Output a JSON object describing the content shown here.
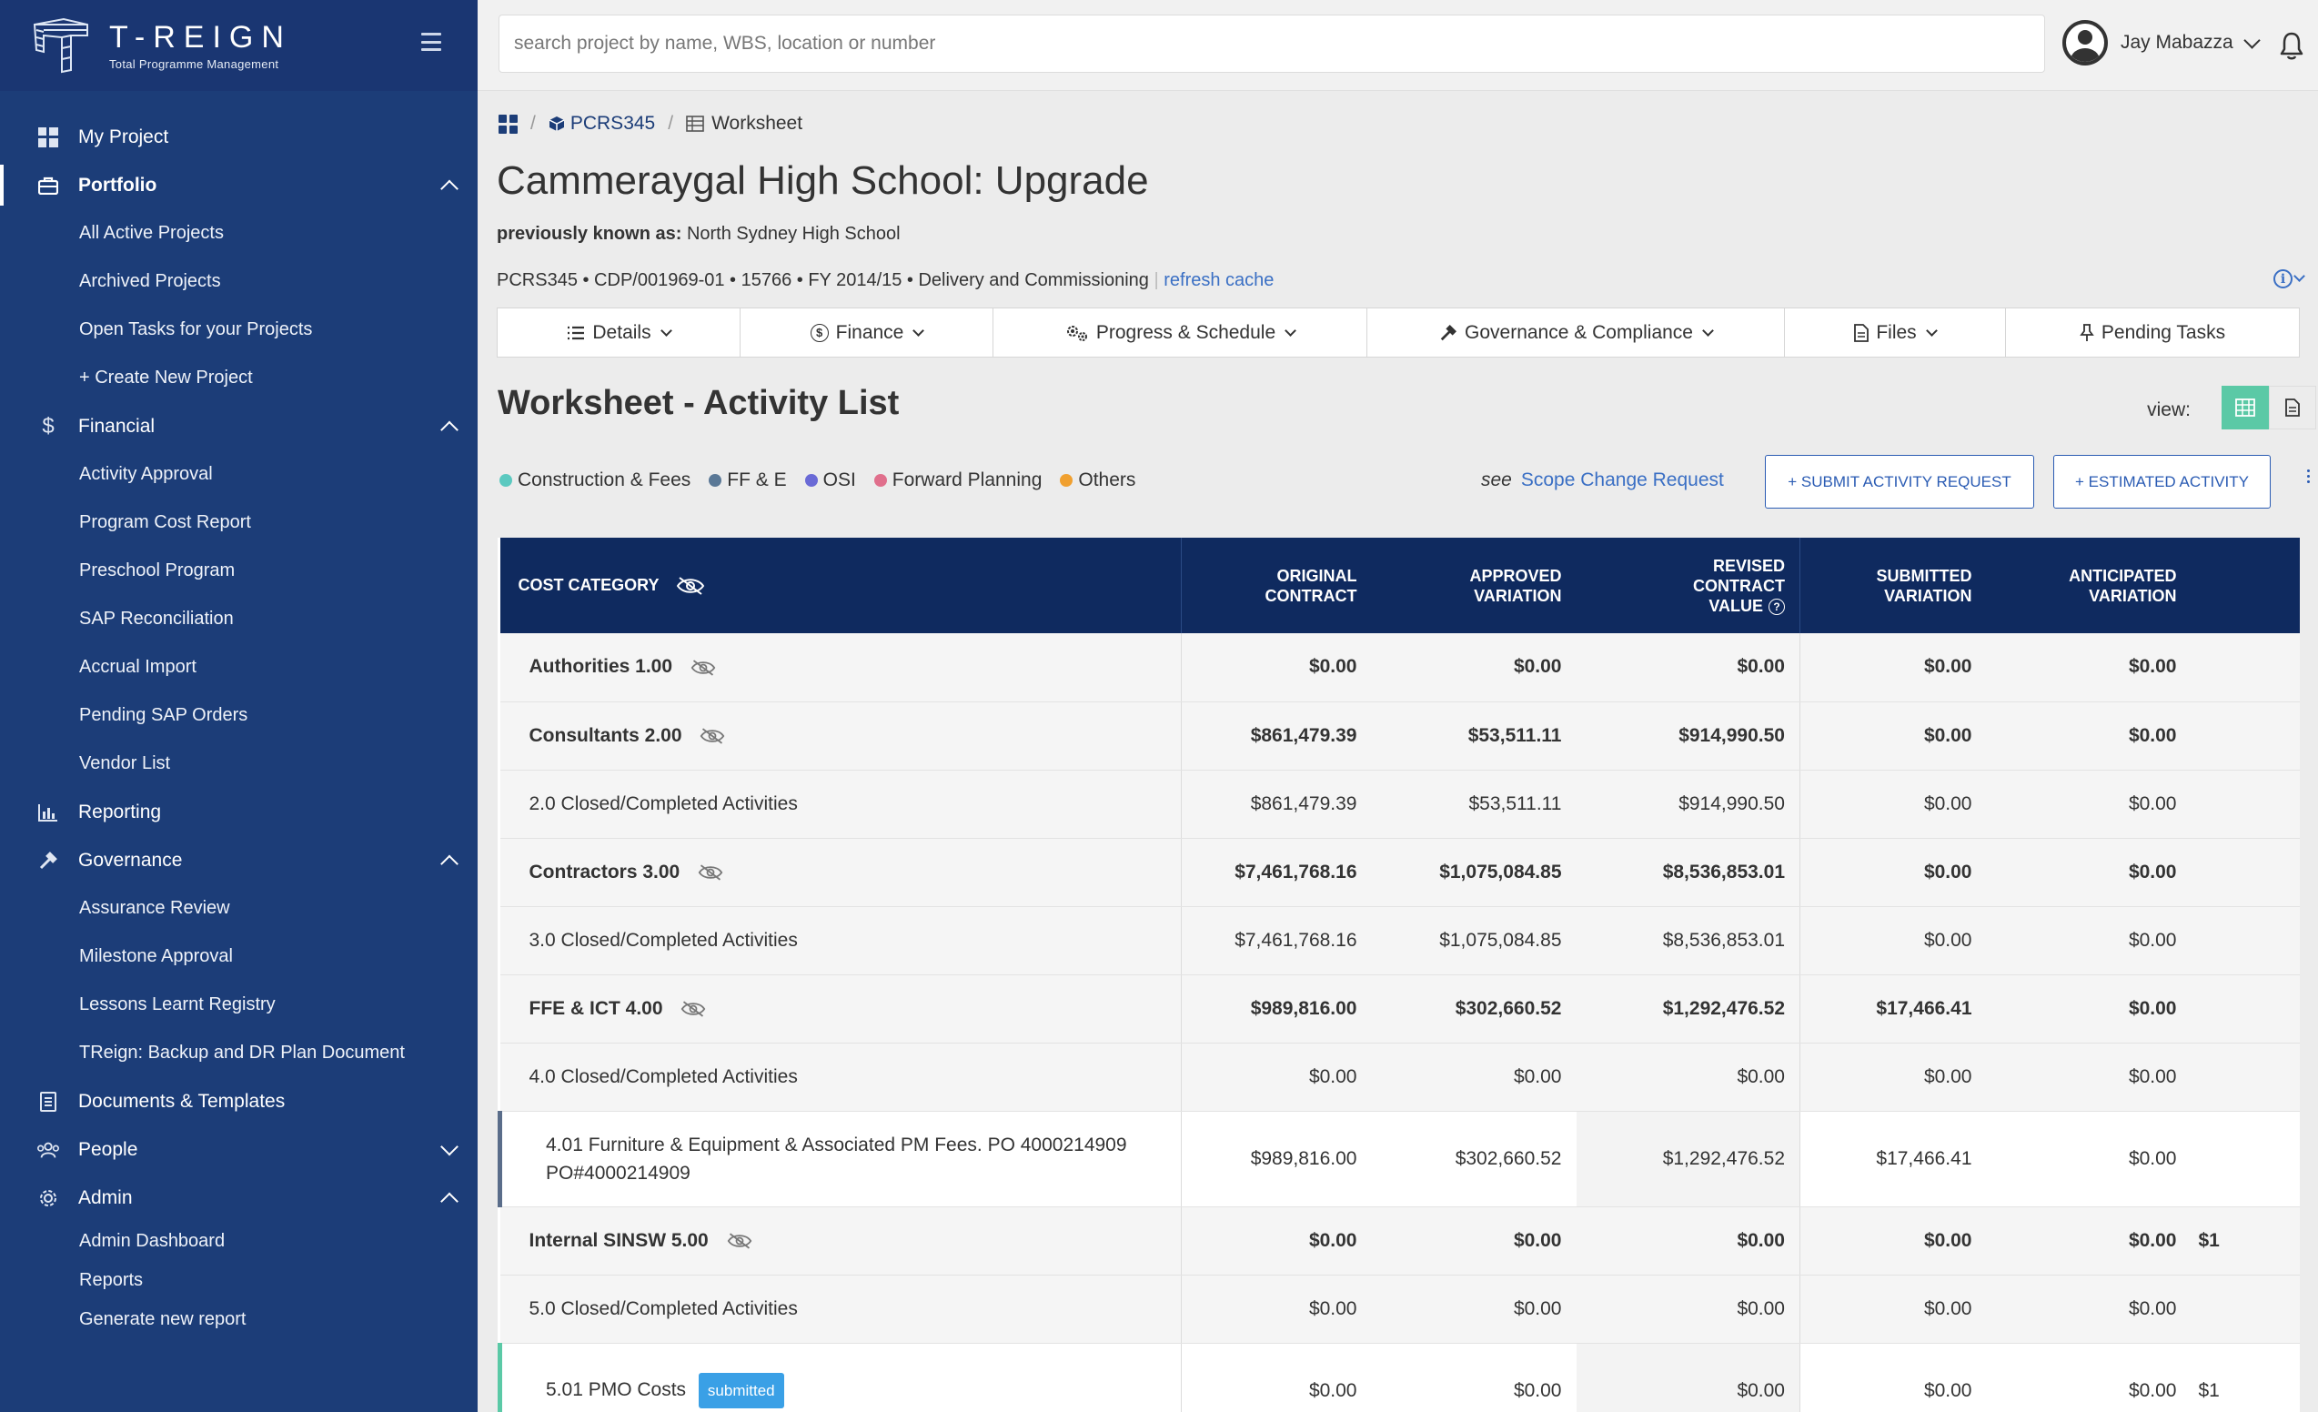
{
  "brand": {
    "title": "T-REIGN",
    "subtitle": "Total Programme Management"
  },
  "sidebar": {
    "items": [
      {
        "label": "My Project",
        "icon": "dashboard-icon"
      },
      {
        "label": "Portfolio",
        "icon": "briefcase-icon",
        "active": true,
        "expanded": true,
        "children": [
          "All Active Projects",
          "Archived Projects",
          "Open Tasks for your Projects",
          "+ Create New Project"
        ]
      },
      {
        "label": "Financial",
        "icon": "dollar-icon",
        "expanded": true,
        "children": [
          "Activity Approval",
          "Program Cost Report",
          "Preschool Program",
          "SAP Reconciliation",
          "Accrual Import",
          "Pending SAP Orders",
          "Vendor List"
        ]
      },
      {
        "label": "Reporting",
        "icon": "bar-chart-icon"
      },
      {
        "label": "Governance",
        "icon": "gavel-icon",
        "expanded": true,
        "children": [
          "Assurance Review",
          "Milestone Approval",
          "Lessons Learnt Registry",
          "TReign: Backup and DR Plan Document"
        ]
      },
      {
        "label": "Documents & Templates",
        "icon": "document-icon"
      },
      {
        "label": "People",
        "icon": "people-icon",
        "expanded": false
      },
      {
        "label": "Admin",
        "icon": "gear-icon",
        "expanded": true,
        "children": [
          "Admin Dashboard",
          "Reports",
          "Generate new report"
        ]
      }
    ]
  },
  "topbar": {
    "search_placeholder": "search project by name, WBS, location or number",
    "user_name": "Jay Mabazza"
  },
  "breadcrumb": {
    "project": "PCRS345",
    "current": "Worksheet"
  },
  "project": {
    "title": "Cammeraygal High School: Upgrade",
    "prev_label": "previously known as:",
    "prev_name": "North Sydney High School",
    "meta": "PCRS345 • CDP/001969-01 • 15766 • FY 2014/15 • Delivery and Commissioning",
    "refresh": "refresh cache"
  },
  "tabs": [
    {
      "label": "Details",
      "icon": "list-icon",
      "dropdown": true
    },
    {
      "label": "Finance",
      "icon": "dollar-circle-icon",
      "dropdown": true
    },
    {
      "label": "Progress & Schedule",
      "icon": "gears-icon",
      "dropdown": true
    },
    {
      "label": "Governance & Compliance",
      "icon": "gavel-icon",
      "dropdown": true
    },
    {
      "label": "Files",
      "icon": "file-icon",
      "dropdown": true
    },
    {
      "label": "Pending Tasks",
      "icon": "pin-icon",
      "dropdown": false
    }
  ],
  "worksheet": {
    "title": "Worksheet - Activity List",
    "view_label": "view:",
    "legend": [
      {
        "label": "Construction & Fees",
        "color": "#5bc9c0"
      },
      {
        "label": "FF & E",
        "color": "#5a7896"
      },
      {
        "label": "OSI",
        "color": "#6a6ad6"
      },
      {
        "label": "Forward Planning",
        "color": "#e06f8c"
      },
      {
        "label": "Others",
        "color": "#f0a030"
      }
    ],
    "see_label": "see",
    "scope_link": "Scope Change Request",
    "submit_btn": "+ SUBMIT ACTIVITY REQUEST",
    "estimated_btn": "+ ESTIMATED ACTIVITY"
  },
  "table": {
    "headers": {
      "category": "COST CATEGORY",
      "original_1": "ORIGINAL",
      "original_2": "CONTRACT",
      "approved_1": "APPROVED",
      "approved_2": "VARIATION",
      "revised_1": "REVISED",
      "revised_2": "CONTRACT",
      "revised_3": "VALUE",
      "submitted_1": "SUBMITTED",
      "submitted_2": "VARIATION",
      "anticipated_1": "ANTICIPATED",
      "anticipated_2": "VARIATION"
    },
    "rows": [
      {
        "cat": "Authorities 1.00",
        "original": "$0.00",
        "approved": "$0.00",
        "revised": "$0.00",
        "submitted": "$0.00",
        "anticipated": "$0.00",
        "extra": ""
      },
      {
        "cat": "Consultants 2.00",
        "original": "$861,479.39",
        "approved": "$53,511.11",
        "revised": "$914,990.50",
        "submitted": "$0.00",
        "anticipated": "$0.00",
        "extra": ""
      },
      {
        "cat": "2.0 Closed/Completed Activities",
        "original": "$861,479.39",
        "approved": "$53,511.11",
        "revised": "$914,990.50",
        "submitted": "$0.00",
        "anticipated": "$0.00",
        "extra": ""
      },
      {
        "cat": "Contractors 3.00",
        "original": "$7,461,768.16",
        "approved": "$1,075,084.85",
        "revised": "$8,536,853.01",
        "submitted": "$0.00",
        "anticipated": "$0.00",
        "extra": ""
      },
      {
        "cat": "3.0 Closed/Completed Activities",
        "original": "$7,461,768.16",
        "approved": "$1,075,084.85",
        "revised": "$8,536,853.01",
        "submitted": "$0.00",
        "anticipated": "$0.00",
        "extra": ""
      },
      {
        "cat": "FFE & ICT 4.00",
        "original": "$989,816.00",
        "approved": "$302,660.52",
        "revised": "$1,292,476.52",
        "submitted": "$17,466.41",
        "anticipated": "$0.00",
        "extra": ""
      },
      {
        "cat": "4.0 Closed/Completed Activities",
        "original": "$0.00",
        "approved": "$0.00",
        "revised": "$0.00",
        "submitted": "$0.00",
        "anticipated": "$0.00",
        "extra": ""
      },
      {
        "cat_line1": "4.01 Furniture & Equipment & Associated PM Fees. PO 4000214909",
        "cat_line2": "PO#4000214909",
        "original": "$989,816.00",
        "approved": "$302,660.52",
        "revised": "$1,292,476.52",
        "submitted": "$17,466.41",
        "anticipated": "$0.00",
        "extra": ""
      },
      {
        "cat": "Internal SINSW 5.00",
        "original": "$0.00",
        "approved": "$0.00",
        "revised": "$0.00",
        "submitted": "$0.00",
        "anticipated": "$0.00",
        "extra": "$1"
      },
      {
        "cat": "5.0 Closed/Completed Activities",
        "original": "$0.00",
        "approved": "$0.00",
        "revised": "$0.00",
        "submitted": "$0.00",
        "anticipated": "$0.00",
        "extra": ""
      },
      {
        "cat": "5.01 PMO Costs",
        "badge": "submitted",
        "original": "$0.00",
        "approved": "$0.00",
        "revised": "$0.00",
        "submitted": "$0.00",
        "anticipated": "$0.00",
        "extra": "$1"
      }
    ]
  }
}
